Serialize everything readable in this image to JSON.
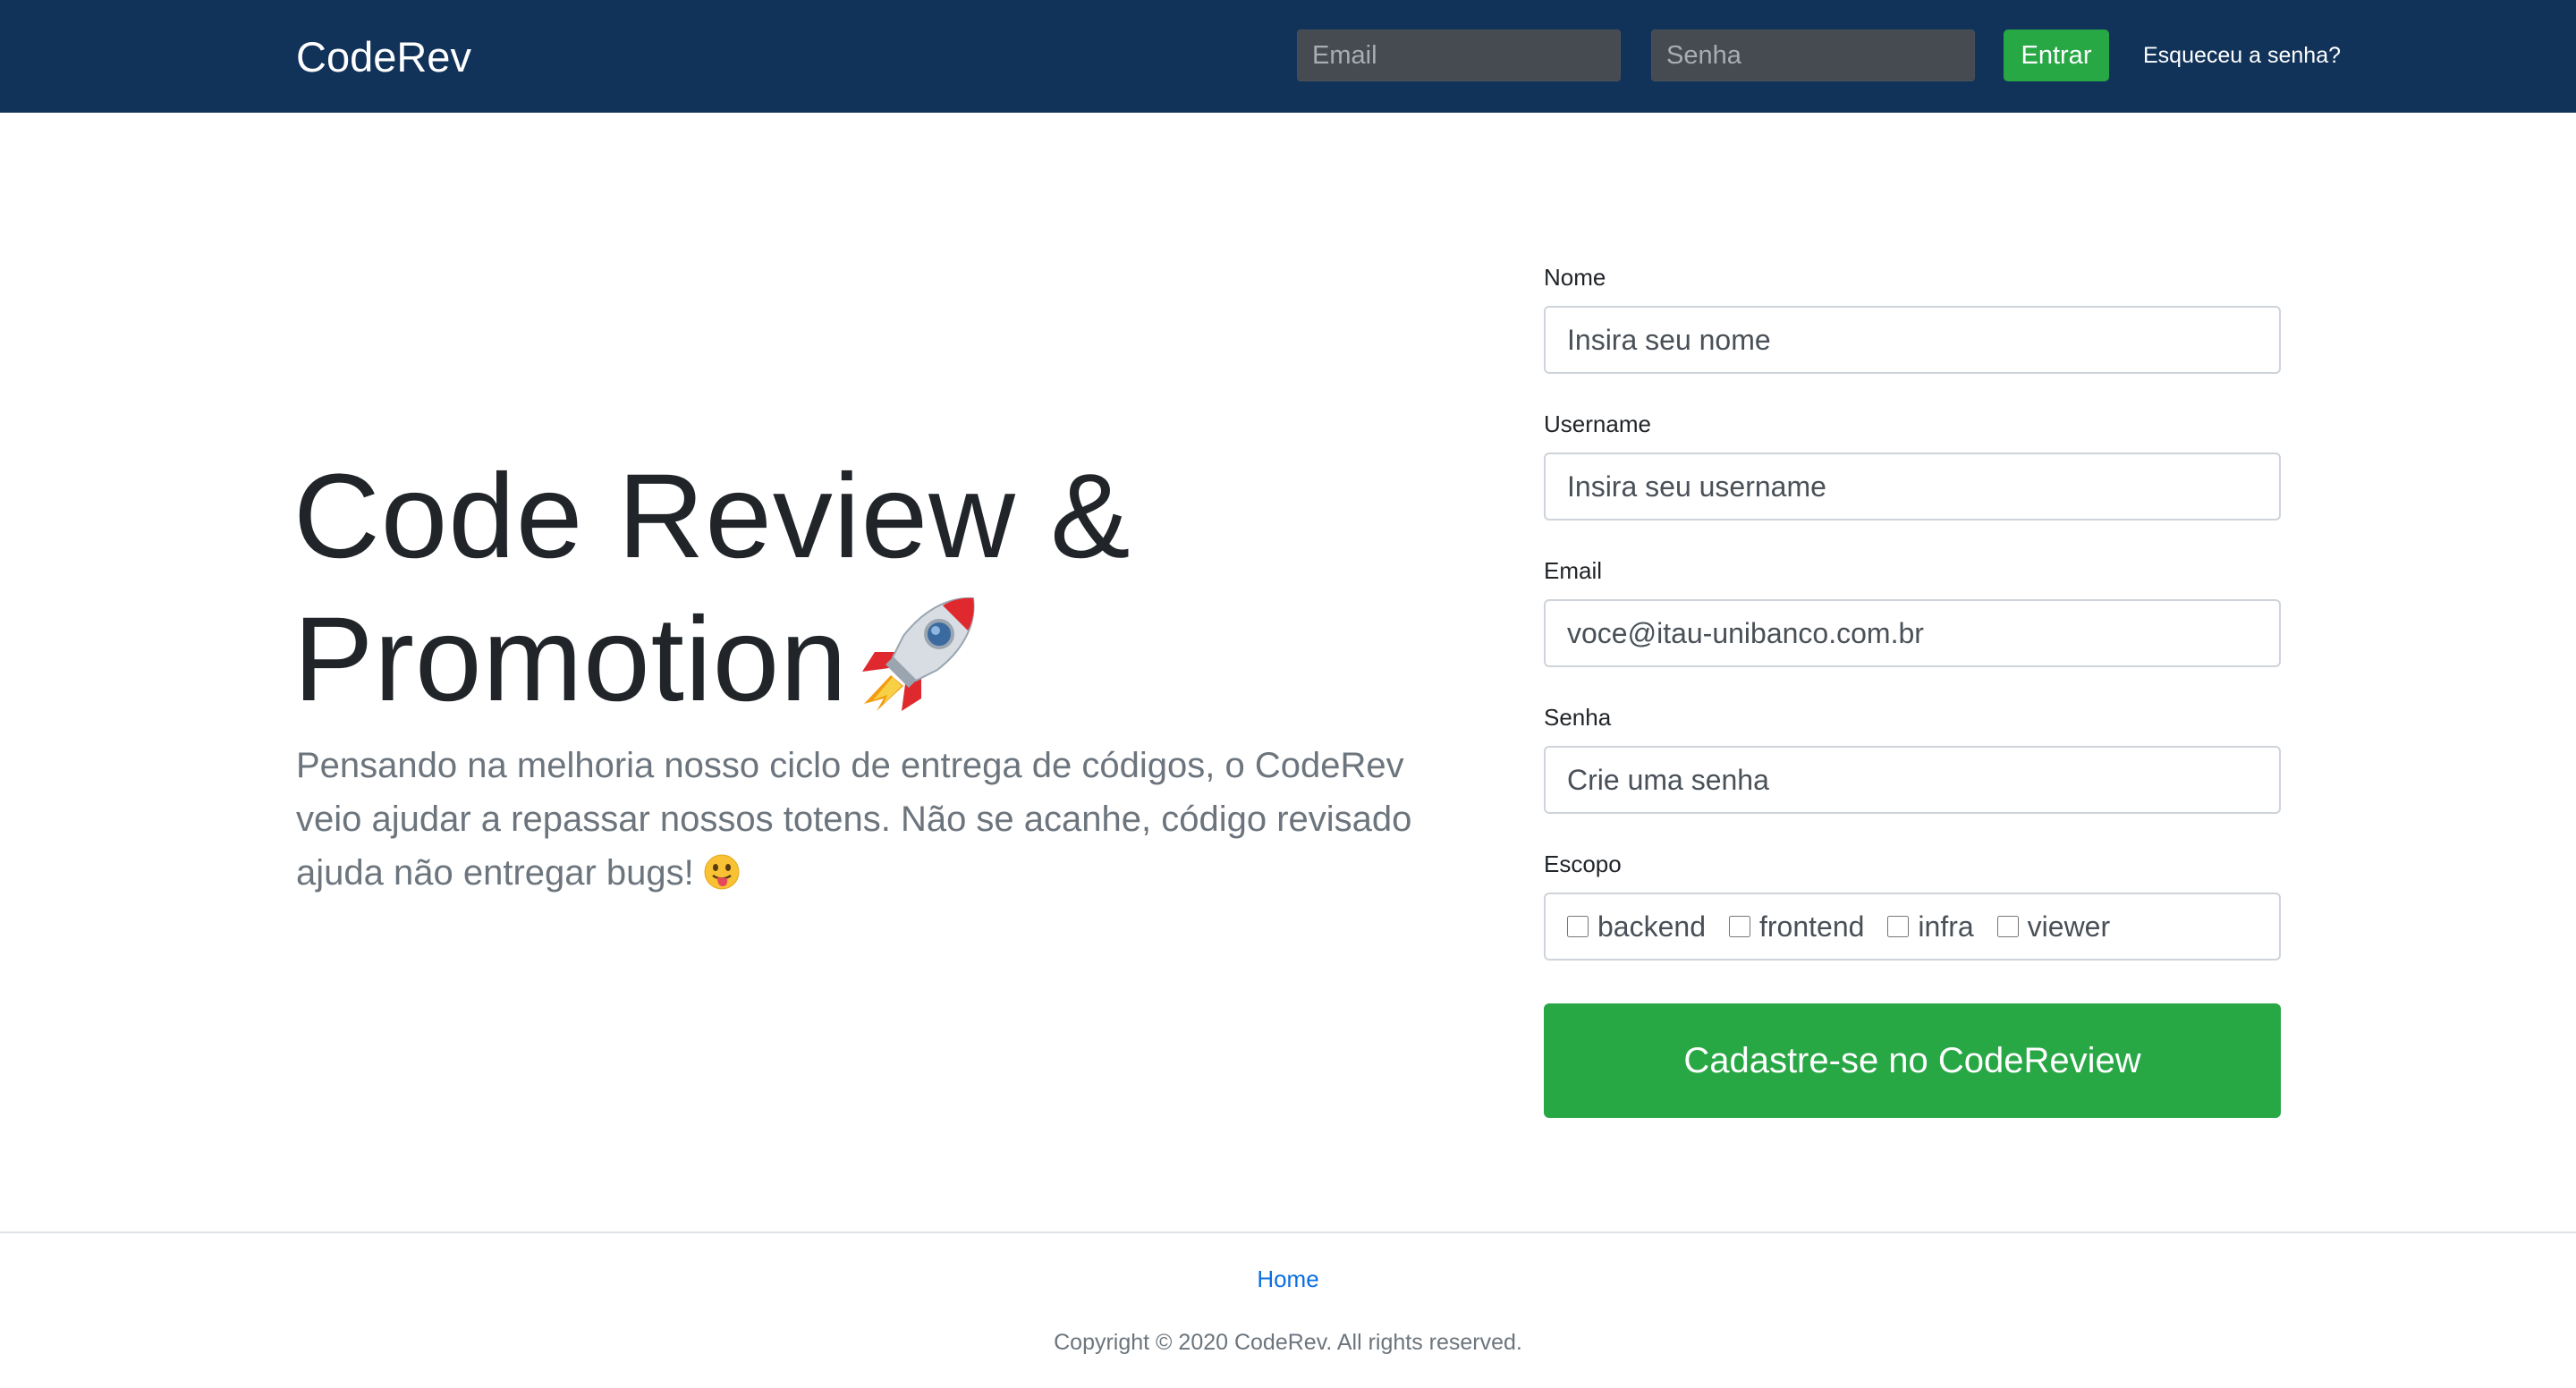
{
  "navbar": {
    "brand": "CodeRev",
    "email_placeholder": "Email",
    "password_placeholder": "Senha",
    "login_label": "Entrar",
    "forgot_label": "Esqueceu a senha?",
    "background_color": "#11335a"
  },
  "hero": {
    "title_line1": "Code Review &",
    "title_line2": "Promotion",
    "title_icon": "rocket-icon",
    "description": "Pensando na melhoria nosso ciclo de entrega de códigos, o CodeRev veio ajudar a repassar nossos totens. Não se acanhe, código revisado ajuda não entregar bugs!",
    "description_icon": "tongue-face-icon"
  },
  "form": {
    "name_label": "Nome",
    "name_placeholder": "Insira seu nome",
    "username_label": "Username",
    "username_placeholder": "Insira seu username",
    "email_label": "Email",
    "email_placeholder": "voce@itau-unibanco.com.br",
    "password_label": "Senha",
    "password_placeholder": "Crie uma senha",
    "scope_label": "Escopo",
    "scopes": [
      "backend",
      "frontend",
      "infra",
      "viewer"
    ],
    "submit_label": "Cadastre-se no CodeReview",
    "accent_color": "#28a745"
  },
  "footer": {
    "home_link": "Home",
    "copyright": "Copyright © 2020 CodeRev. All rights reserved."
  }
}
